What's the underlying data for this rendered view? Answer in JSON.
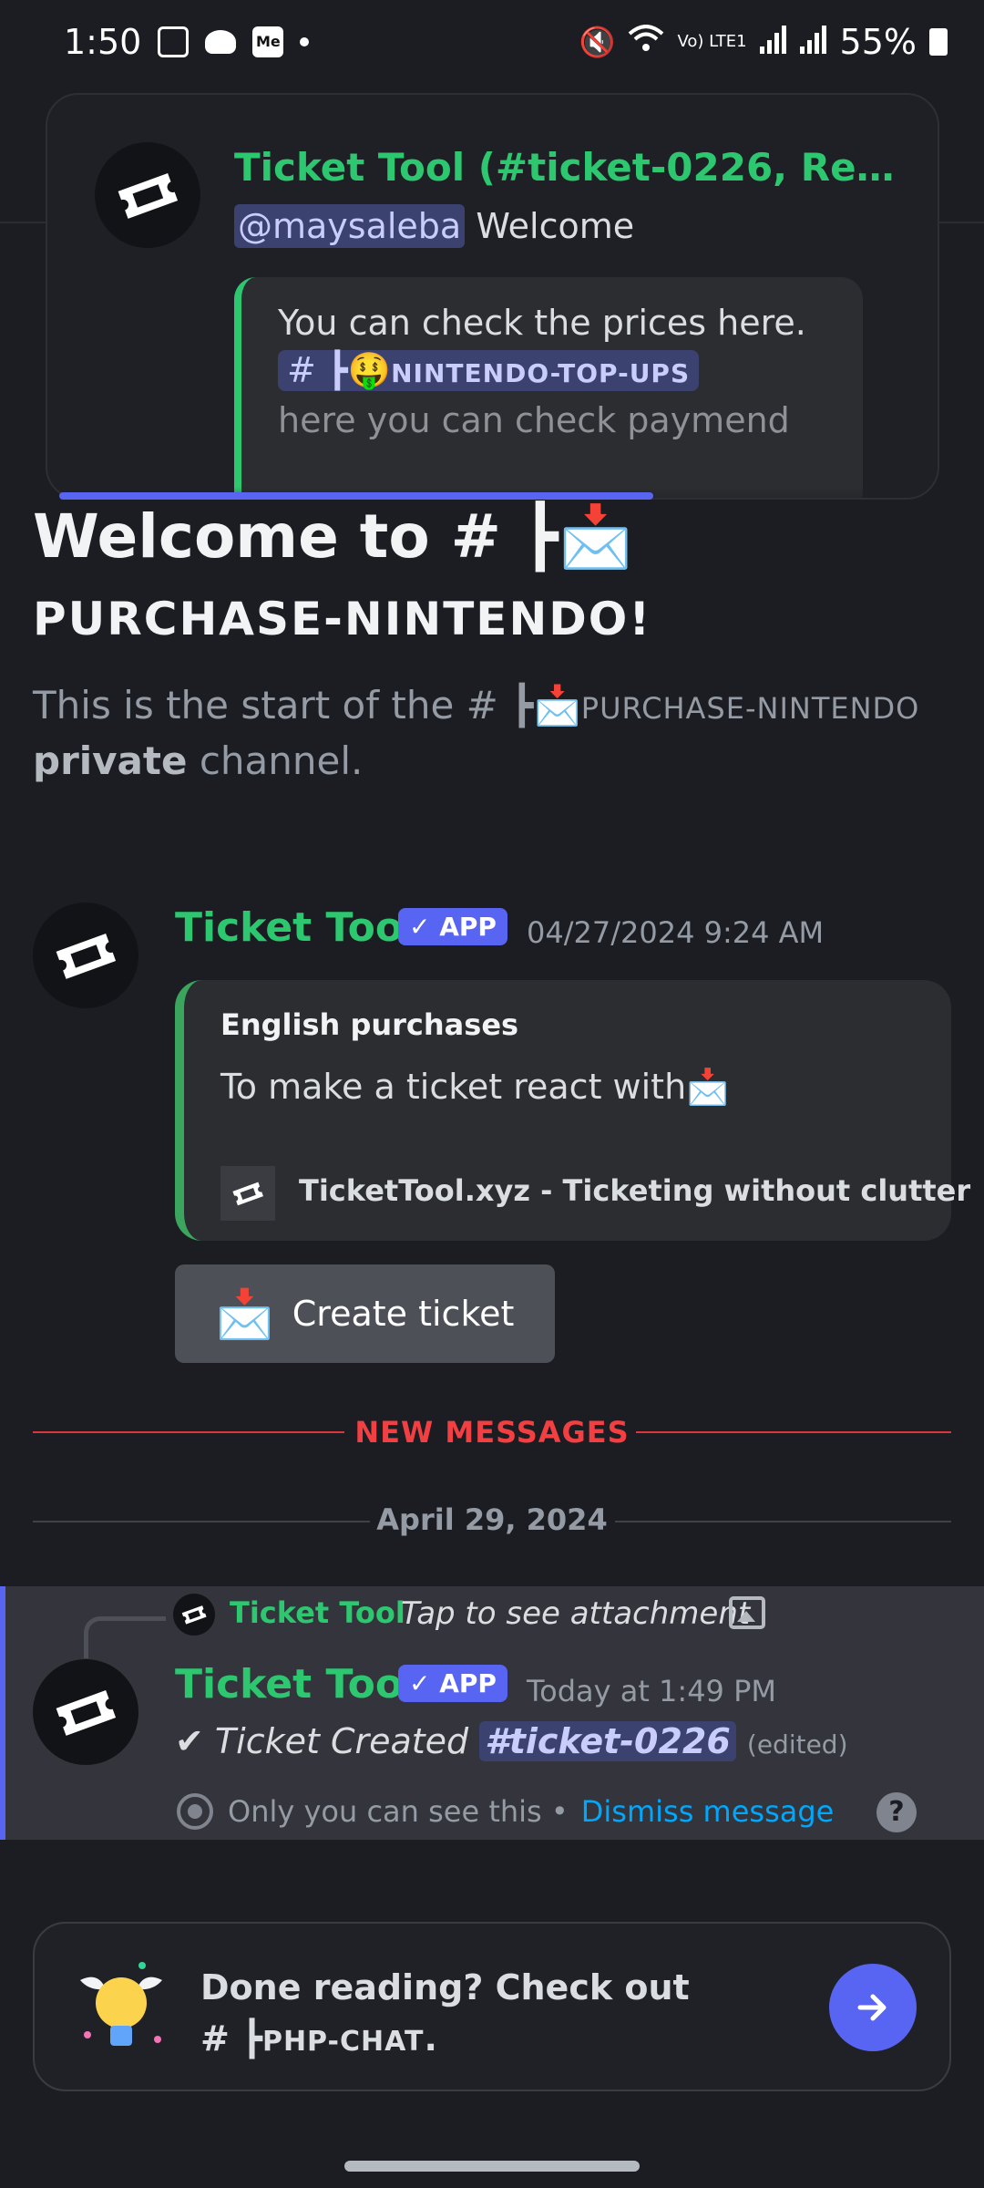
{
  "status_bar": {
    "time": "1:50",
    "battery": "55%",
    "network": "Vo) LTE1",
    "icons": [
      "image-icon",
      "cloud-icon",
      "me-icon",
      "dot-icon",
      "mute-icon",
      "wifi-icon",
      "signal-icon",
      "roaming-signal-icon",
      "battery-icon"
    ]
  },
  "notification": {
    "title": "Ticket Tool (#ticket-0226, Regio...",
    "mention": "@maysaleba",
    "line_rest": "Welcome",
    "embed_line1": "You can check the prices here.",
    "channel_prefix": "# ┣🤑",
    "channel_name": "NINTENDO-TOP-UPS",
    "embed_line3": "here you can check paymend"
  },
  "welcome": {
    "title": "Welcome to # ┣📩",
    "subtitle": "PURCHASE-NINTENDO!",
    "desc_start": "This is the start of the # ┣📩",
    "desc_channel": "PURCHASE-NINTENDO",
    "desc_private": "private",
    "desc_end": "channel."
  },
  "message1": {
    "author": "Ticket Tool",
    "badge": "✓ APP",
    "timestamp": "04/27/2024 9:24 AM",
    "embed_title": "English purchases",
    "embed_desc": "To make a ticket react with📩",
    "embed_footer": "TicketTool.xyz - Ticketing without clutter",
    "button_emoji": "📩",
    "button_label": "Create ticket"
  },
  "dividers": {
    "new_messages": "NEW MESSAGES",
    "date": "April 29, 2024"
  },
  "message2": {
    "reply_author": "Ticket Tool",
    "reply_text": "Tap to see attachment",
    "author": "Ticket Tool",
    "badge": "✓ APP",
    "timestamp": "Today at 1:49 PM",
    "text_prefix": "✔ Ticket Created ",
    "channel": "#ticket-0226",
    "edited": "(edited)",
    "only_you": "Only you can see this •",
    "dismiss": "Dismiss message",
    "help": "?"
  },
  "bottom_prompt": {
    "line1": "Done reading? Check out",
    "channel_prefix": "# ┣",
    "channel_name": "PHP-CHAT",
    "suffix": "."
  },
  "colors": {
    "background": "#1c1d22",
    "brand": "#5865f2",
    "bot_green": "#2dc770",
    "new_red": "#f23f42",
    "link": "#00a8fc"
  }
}
